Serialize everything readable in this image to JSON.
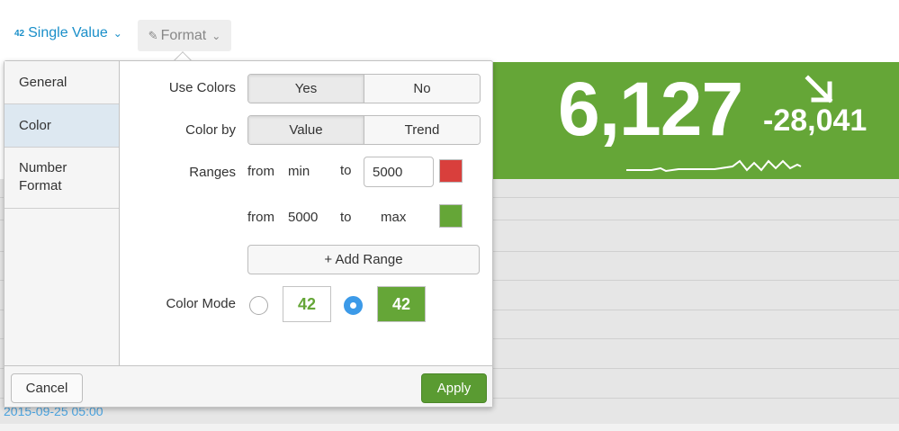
{
  "toolbar": {
    "viz_type_label": "Single Value",
    "viz_type_icon": "42",
    "format_label": "Format"
  },
  "visualization": {
    "value": "6,127",
    "delta": "-28,041",
    "trend": "down",
    "background_color": "#65a637",
    "table_date": "2015-09-25 05:00"
  },
  "format_panel": {
    "nav": [
      {
        "label": "General",
        "active": false
      },
      {
        "label": "Color",
        "active": true
      },
      {
        "label": "Number Format",
        "active": false
      }
    ],
    "use_colors": {
      "label": "Use Colors",
      "options": [
        "Yes",
        "No"
      ],
      "selected": "Yes"
    },
    "color_by": {
      "label": "Color by",
      "options": [
        "Value",
        "Trend"
      ],
      "selected": "Value"
    },
    "ranges": {
      "label": "Ranges",
      "rows": [
        {
          "from_label": "from",
          "from": "min",
          "to_label": "to",
          "to": "5000",
          "color": "#d93f3c"
        },
        {
          "from_label": "from",
          "from": "5000",
          "to_label": "to",
          "to": "max",
          "color": "#65a637"
        }
      ],
      "add_label": "+ Add Range"
    },
    "color_mode": {
      "label": "Color Mode",
      "sample": "42",
      "options": [
        "text",
        "block"
      ],
      "selected": "block"
    },
    "cancel_label": "Cancel",
    "apply_label": "Apply"
  }
}
